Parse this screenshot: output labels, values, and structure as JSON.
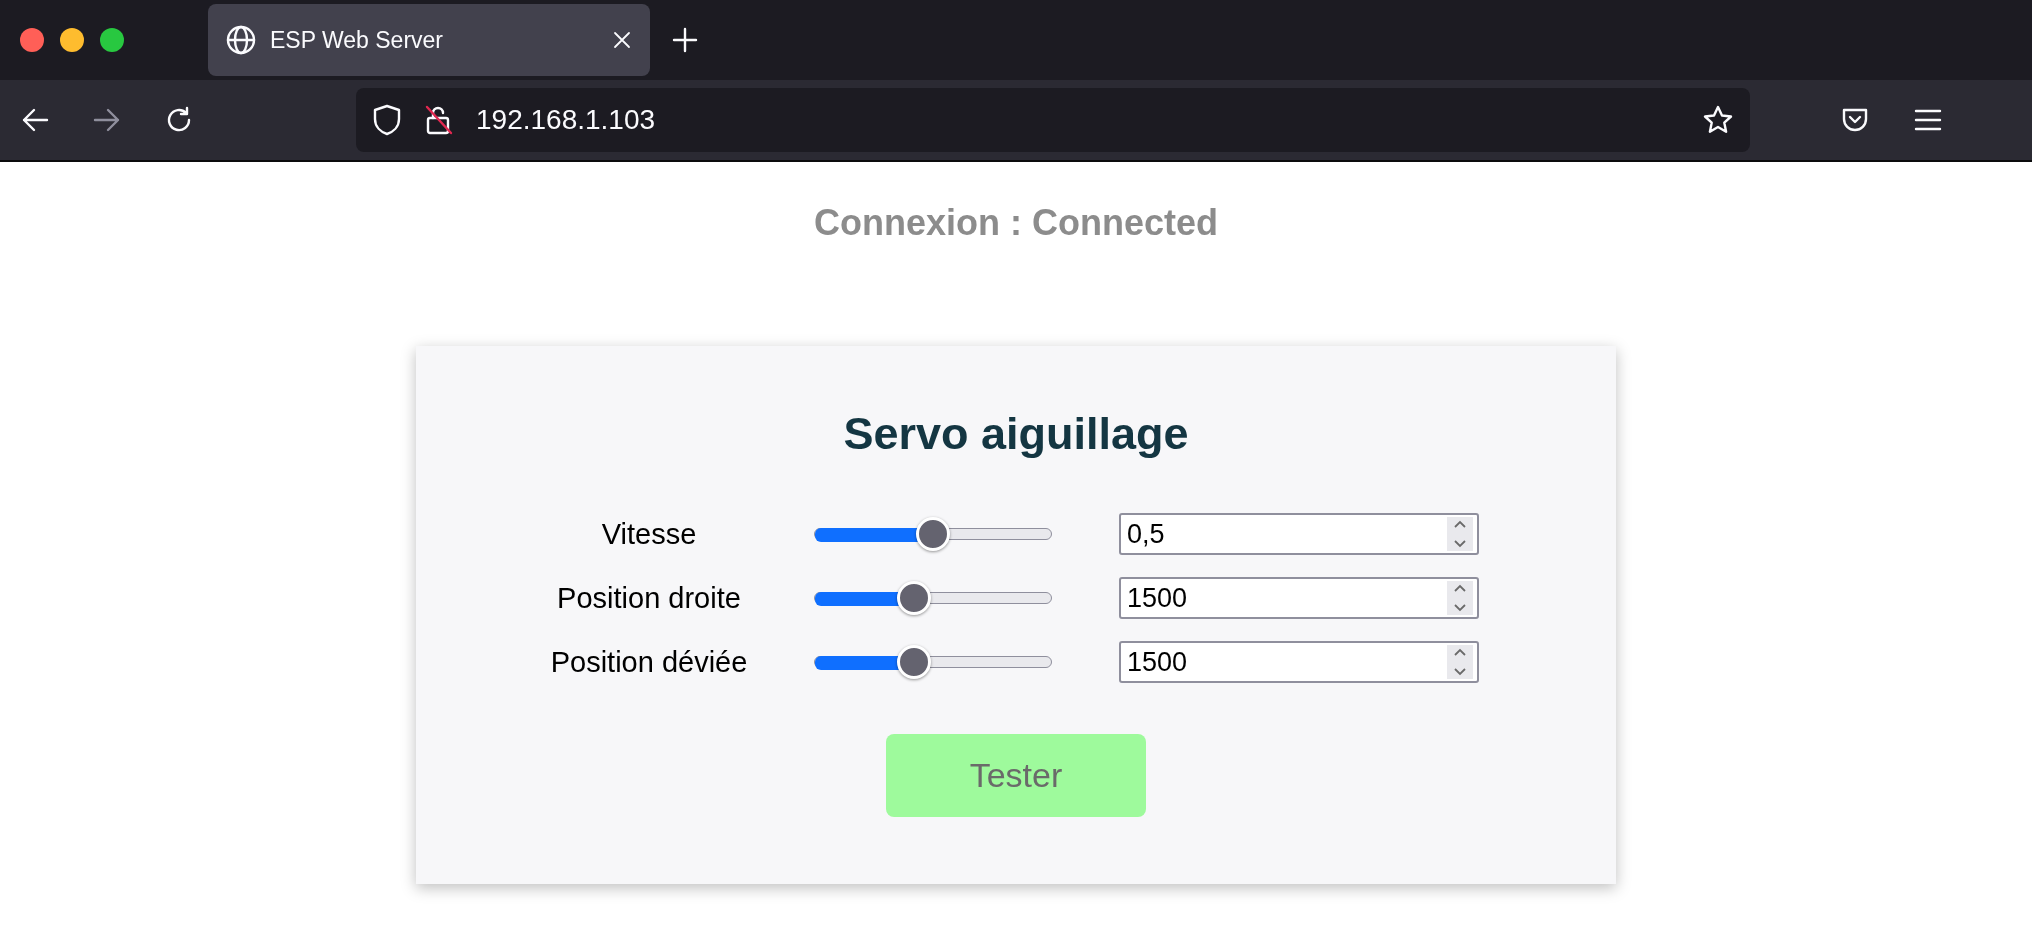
{
  "browser": {
    "tab": {
      "title": "ESP Web Server",
      "selected": true
    },
    "address": "192.168.1.103"
  },
  "connection": "Connexion : Connected",
  "card": {
    "title": "Servo aiguillage",
    "rows": [
      {
        "label": "Vitesse",
        "level": 0.5,
        "value": "0,5"
      },
      {
        "label": "Position droite",
        "level": 0.42,
        "value": "1500"
      },
      {
        "label": "Position déviée",
        "level": 0.42,
        "value": "1500"
      }
    ],
    "button": "Tester"
  }
}
